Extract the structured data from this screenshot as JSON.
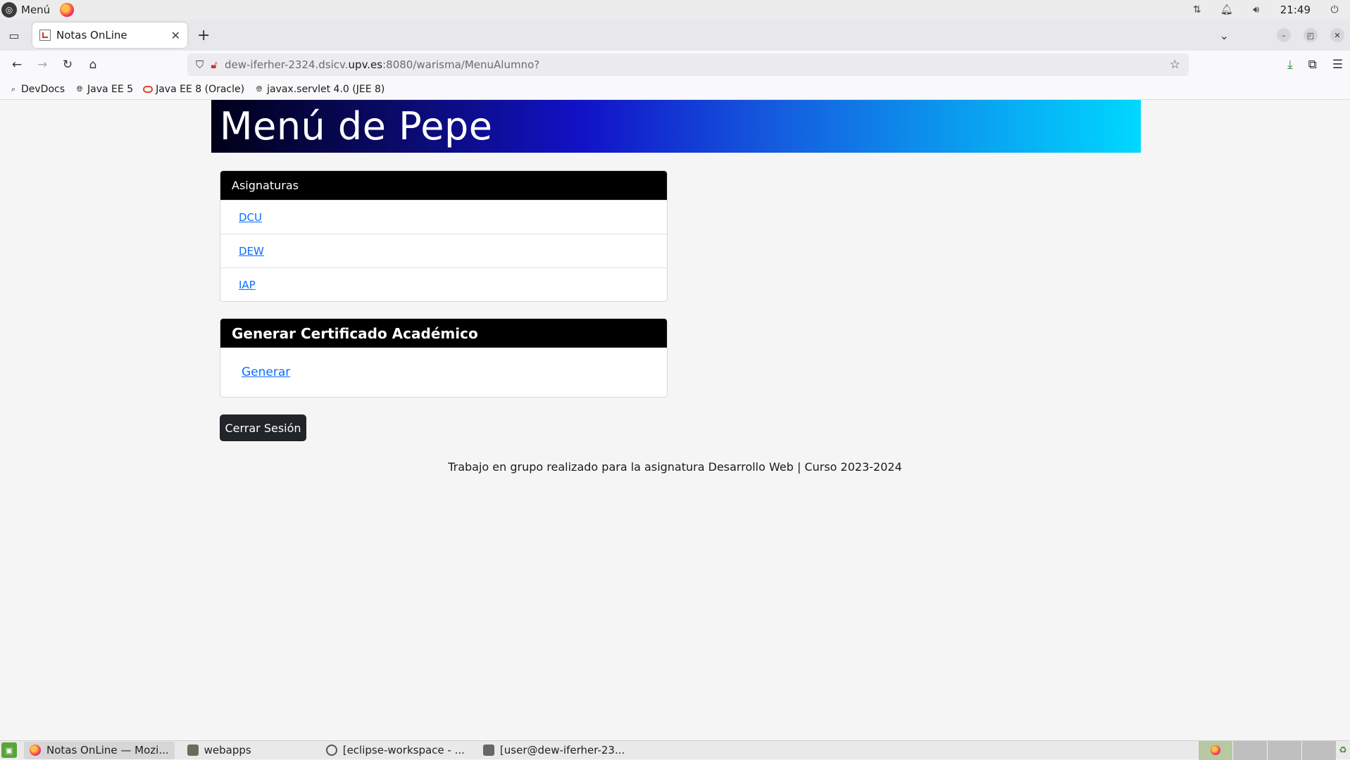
{
  "os_panel": {
    "menu_label": "Menú",
    "clock": "21:49"
  },
  "browser": {
    "tab_title": "Notas OnLine",
    "url_prefix": "dew-iferher-2324.dsicv.",
    "url_host": "upv.es",
    "url_suffix": ":8080/warisma/MenuAlumno?",
    "bookmarks": [
      {
        "label": "DevDocs",
        "icon": "search-icon"
      },
      {
        "label": "Java EE 5",
        "icon": "globe-icon"
      },
      {
        "label": "Java EE 8 (Oracle)",
        "icon": "oracle-icon"
      },
      {
        "label": "javax.servlet 4.0 (JEE 8)",
        "icon": "globe-icon"
      }
    ]
  },
  "page": {
    "banner_title": "Menú de Pepe",
    "subjects": {
      "header": "Asignaturas",
      "items": [
        "DCU",
        "DEW",
        "IAP"
      ]
    },
    "certificate": {
      "header": "Generar Certificado Académico",
      "link": "Generar"
    },
    "logout_button": "Cerrar Sesión",
    "footer": "Trabajo en grupo realizado para la asignatura Desarrollo Web | Curso 2023-2024"
  },
  "taskbar": {
    "tasks": [
      {
        "label": "Notas OnLine — Mozi...",
        "icon": "firefox-icon",
        "active": true
      },
      {
        "label": "webapps",
        "icon": "folder-icon",
        "active": false
      },
      {
        "label": "[eclipse-workspace - ...",
        "icon": "eclipse-icon",
        "active": false
      },
      {
        "label": "[user@dew-iferher-23...",
        "icon": "terminal-icon",
        "active": false
      }
    ]
  },
  "colors": {
    "banner_gradient_start": "#000018",
    "banner_gradient_end": "#00d8ff",
    "link": "#0d6efd",
    "card_header": "#000000",
    "logout_button": "#212529"
  }
}
